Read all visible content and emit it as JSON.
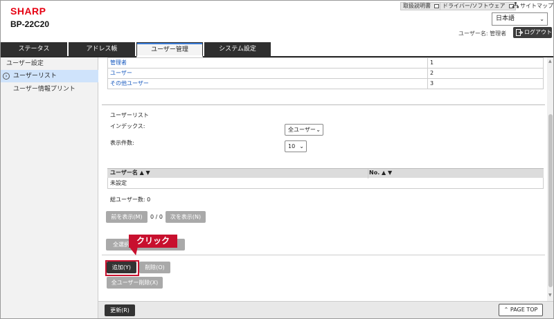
{
  "header": {
    "logo": "SHARP",
    "model": "BP-22C20",
    "links": {
      "manual": "取扱説明書",
      "driver": "ドライバー/ソフトウェア",
      "sitemap": "サイトマップ"
    },
    "language": "日本語",
    "user_label": "ユーザー名: 管理者",
    "logout": "ログアウト"
  },
  "tabs": [
    {
      "label": "ステータス"
    },
    {
      "label": "アドレス帳"
    },
    {
      "label": "ユーザー管理"
    },
    {
      "label": "システム設定"
    }
  ],
  "sidebar": {
    "header": "ユーザー設定",
    "items": [
      {
        "label": "ユーザーリスト"
      },
      {
        "label": "ユーザー情報プリント"
      }
    ]
  },
  "role_table": {
    "rows": [
      {
        "name": "管理者",
        "value": "1"
      },
      {
        "name": "ユーザー",
        "value": "2"
      },
      {
        "name": "その他ユーザー",
        "value": "3"
      }
    ]
  },
  "user_list": {
    "section_title": "ユーザーリスト",
    "index_label": "インデックス:",
    "index_value": "全ユーザー",
    "count_label": "表示件数:",
    "count_value": "10",
    "col_user": "ユーザー名 ▲ ▼",
    "col_no": "No. ▲ ▼",
    "empty_row": "未設定",
    "total_label": "総ユーザー数:  0",
    "prev": "前を表示(M)",
    "pager": "0 / 0",
    "next": "次を表示(N)"
  },
  "actions": {
    "select_all": "全選択",
    "add": "追加(Y)",
    "delete": "削除(O)",
    "delete_all": "全ユーザー削除(X)"
  },
  "callout": "クリック",
  "footer": {
    "refresh": "更新(R)",
    "page_top": "PAGE TOP"
  },
  "colors": {
    "brand_red": "#e60012",
    "callout_red": "#c8102e",
    "tab_dark": "#2f2f2f",
    "link_blue": "#1a5bbf",
    "selected_bg": "#cfe3fb"
  }
}
